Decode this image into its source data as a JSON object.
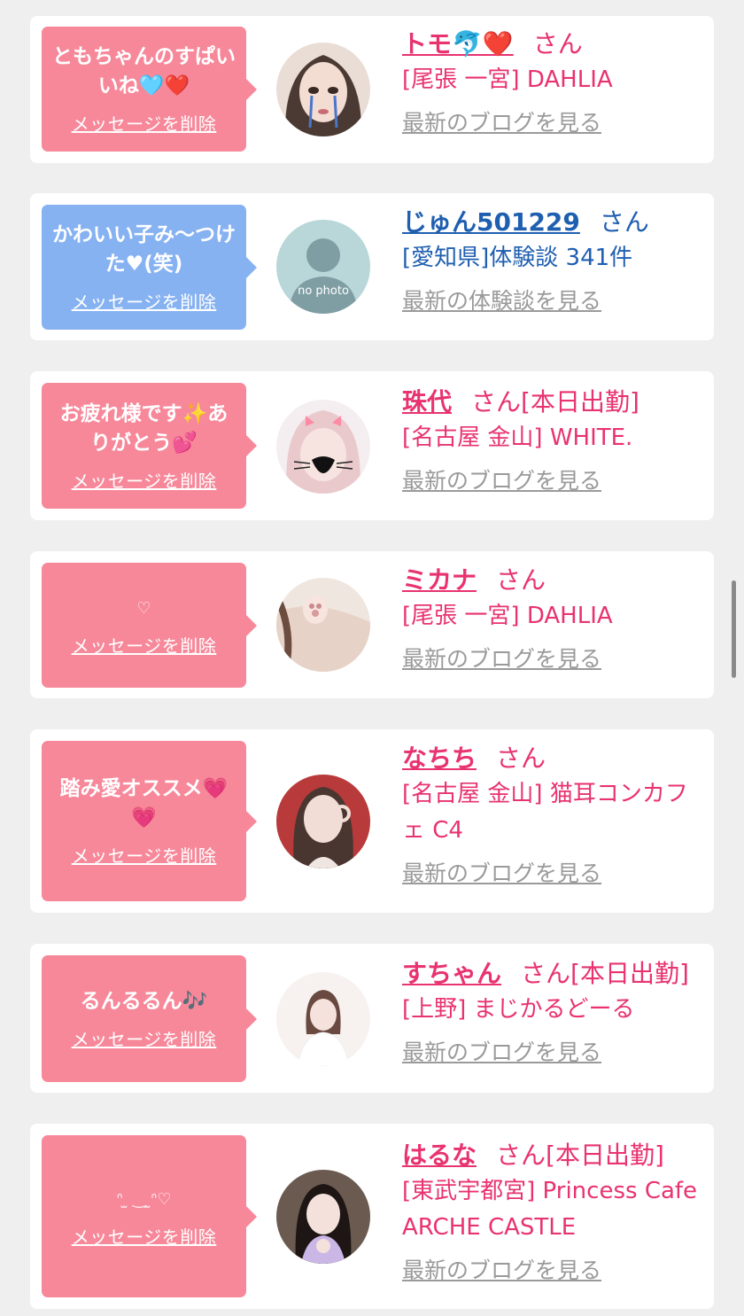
{
  "delete_label": "メッセージを削除",
  "san": "さん",
  "colors": {
    "pink_bubble": "#f7889a",
    "blue_bubble": "#86b2f2",
    "name_pink": "#e8336f",
    "name_blue": "#1f5fb0"
  },
  "cards": [
    {
      "message": "ともちゃんのすぱいいね🩵❤️",
      "name": "トモ🐬❤️",
      "status": "",
      "shop": "[尾張 一宮] DAHLIA",
      "link": "最新のブログを見る",
      "theme": "pink"
    },
    {
      "message": "かわいい子み〜つけた♥(笑)",
      "name": "じゅん501229",
      "status": "",
      "shop": "[愛知県]体験談 341件",
      "link": "最新の体験談を見る",
      "theme": "blue",
      "avatar_text": "no photo"
    },
    {
      "message": "お疲れ様です✨ありがとう💕",
      "name": "珠代",
      "status": "[本日出勤]",
      "shop": "[名古屋 金山] WHITE.",
      "link": "最新のブログを見る",
      "theme": "pink"
    },
    {
      "message": "♡",
      "name": "ミカナ",
      "status": "",
      "shop": "[尾張 一宮] DAHLIA",
      "link": "最新のブログを見る",
      "theme": "pink"
    },
    {
      "message": "踏み愛オススメ💗💗",
      "name": "なちち",
      "status": "",
      "shop": "[名古屋 金山] 猫耳コンカフェ C4",
      "link": "最新のブログを見る",
      "theme": "pink"
    },
    {
      "message": "るんるるん🎶",
      "name": "すちゃん",
      "status": "[本日出勤]",
      "shop": "[上野] まじかるどーる",
      "link": "最新のブログを見る",
      "theme": "pink"
    },
    {
      "message": "ᐢ ̫ ‿ ̫ᐢ♡",
      "name": "はるな",
      "status": "[本日出勤]",
      "shop": "[東武宇都宮] Princess Cafe ARCHE CASTLE",
      "link": "最新のブログを見る",
      "theme": "pink"
    }
  ]
}
